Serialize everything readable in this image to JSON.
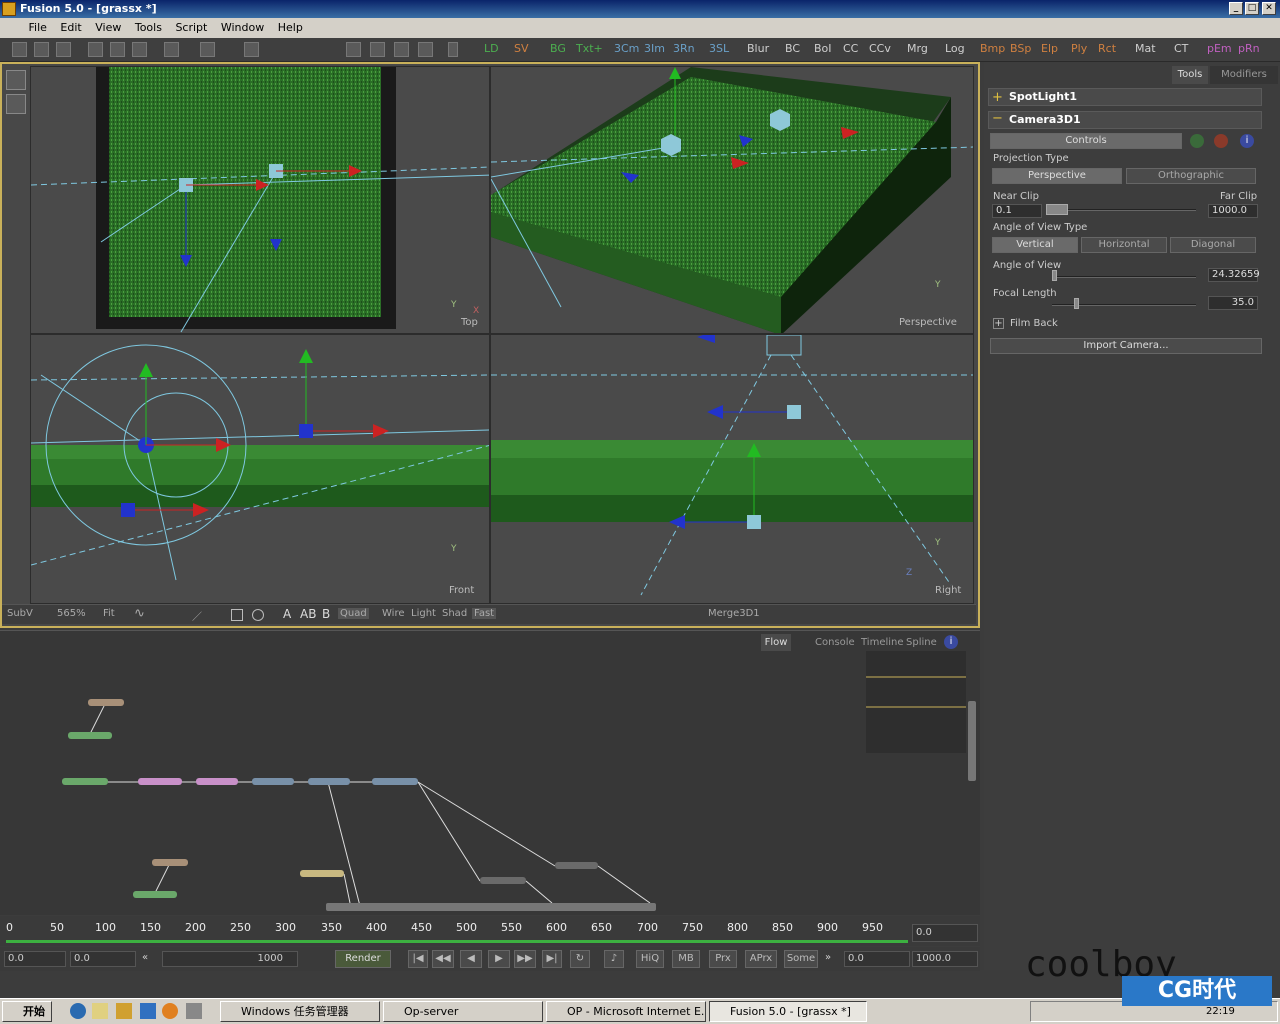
{
  "window": {
    "title": "Fusion 5.0 - [grassx *]",
    "min": "_",
    "max": "□",
    "close": "✕"
  },
  "menu": [
    "File",
    "Edit",
    "View",
    "Tools",
    "Script",
    "Window",
    "Help"
  ],
  "toolbar": {
    "tools": [
      "LD",
      "SV",
      "BG",
      "Txt+",
      "3Cm",
      "3Im",
      "3Rn",
      "3SL",
      "Blur",
      "BC",
      "BoI",
      "CC",
      "CCv",
      "Mrg",
      "Log",
      "Bmp",
      "BSp",
      "Elp",
      "Ply",
      "Rct",
      "Mat",
      "CT",
      "pEm",
      "pRn"
    ]
  },
  "viewports": {
    "top": "Top",
    "perspective": "Perspective",
    "front": "Front",
    "right": "Right",
    "axis_y": "Y",
    "axis_x": "X",
    "axis_z": "Z"
  },
  "viewbar": {
    "subv": "SubV",
    "zoom": "565%",
    "fit": "Fit",
    "a": "A",
    "ab": "AB",
    "b": "B",
    "quad": "Quad",
    "wire": "Wire",
    "light": "Light",
    "shad": "Shad",
    "fast": "Fast",
    "node": "Merge3D1"
  },
  "panel": {
    "tabs": {
      "tools": "Tools",
      "modifiers": "Modifiers"
    },
    "spotlight": "SpotLight1",
    "camera": "Camera3D1",
    "controls": "Controls",
    "projection_type": "Projection Type",
    "perspective": "Perspective",
    "orthographic": "Orthographic",
    "near_clip": "Near Clip",
    "far_clip": "Far Clip",
    "near_value": "0.1",
    "far_value": "1000.0",
    "angle_type": "Angle of View Type",
    "vertical": "Vertical",
    "horizontal": "Horizontal",
    "diagonal": "Diagonal",
    "angle_of_view": "Angle of View",
    "aov_value": "24.32659",
    "focal_length": "Focal Length",
    "focal_value": "35.0",
    "film_back": "Film Back",
    "import_camera": "Import Camera..."
  },
  "flow_tabs": {
    "flow": "Flow",
    "console": "Console",
    "timeline": "Timeline",
    "spline": "Spline"
  },
  "timeline": {
    "ticks": [
      "0",
      "50",
      "100",
      "150",
      "200",
      "250",
      "300",
      "350",
      "400",
      "450",
      "500",
      "550",
      "600",
      "650",
      "700",
      "750",
      "800",
      "850",
      "900",
      "950"
    ],
    "right_value": "0.0"
  },
  "transport": {
    "start": "0.0",
    "current": "0.0",
    "end_value": "1000",
    "render": "Render",
    "hiq": "HiQ",
    "mb": "MB",
    "prx": "Prx",
    "aprx": "APrx",
    "some": "Some",
    "render_start": "0.0",
    "render_end": "1000.0"
  },
  "taskbar": {
    "start": "开始",
    "tasks": [
      "Windows 任务管理器",
      "Op-server",
      "OP - Microsoft Internet E...",
      "Fusion 5.0 - [grassx *]"
    ],
    "clock": "22:19",
    "watermark": "coolboy",
    "cg_logo": "CG时代"
  },
  "colors": {
    "grass": "#2f7a2a",
    "accent_border": "#c9b15a",
    "axis_red": "#cc2222",
    "axis_green": "#22bb22",
    "axis_blue": "#2233cc",
    "wire_cyan": "#7fc8e0"
  }
}
